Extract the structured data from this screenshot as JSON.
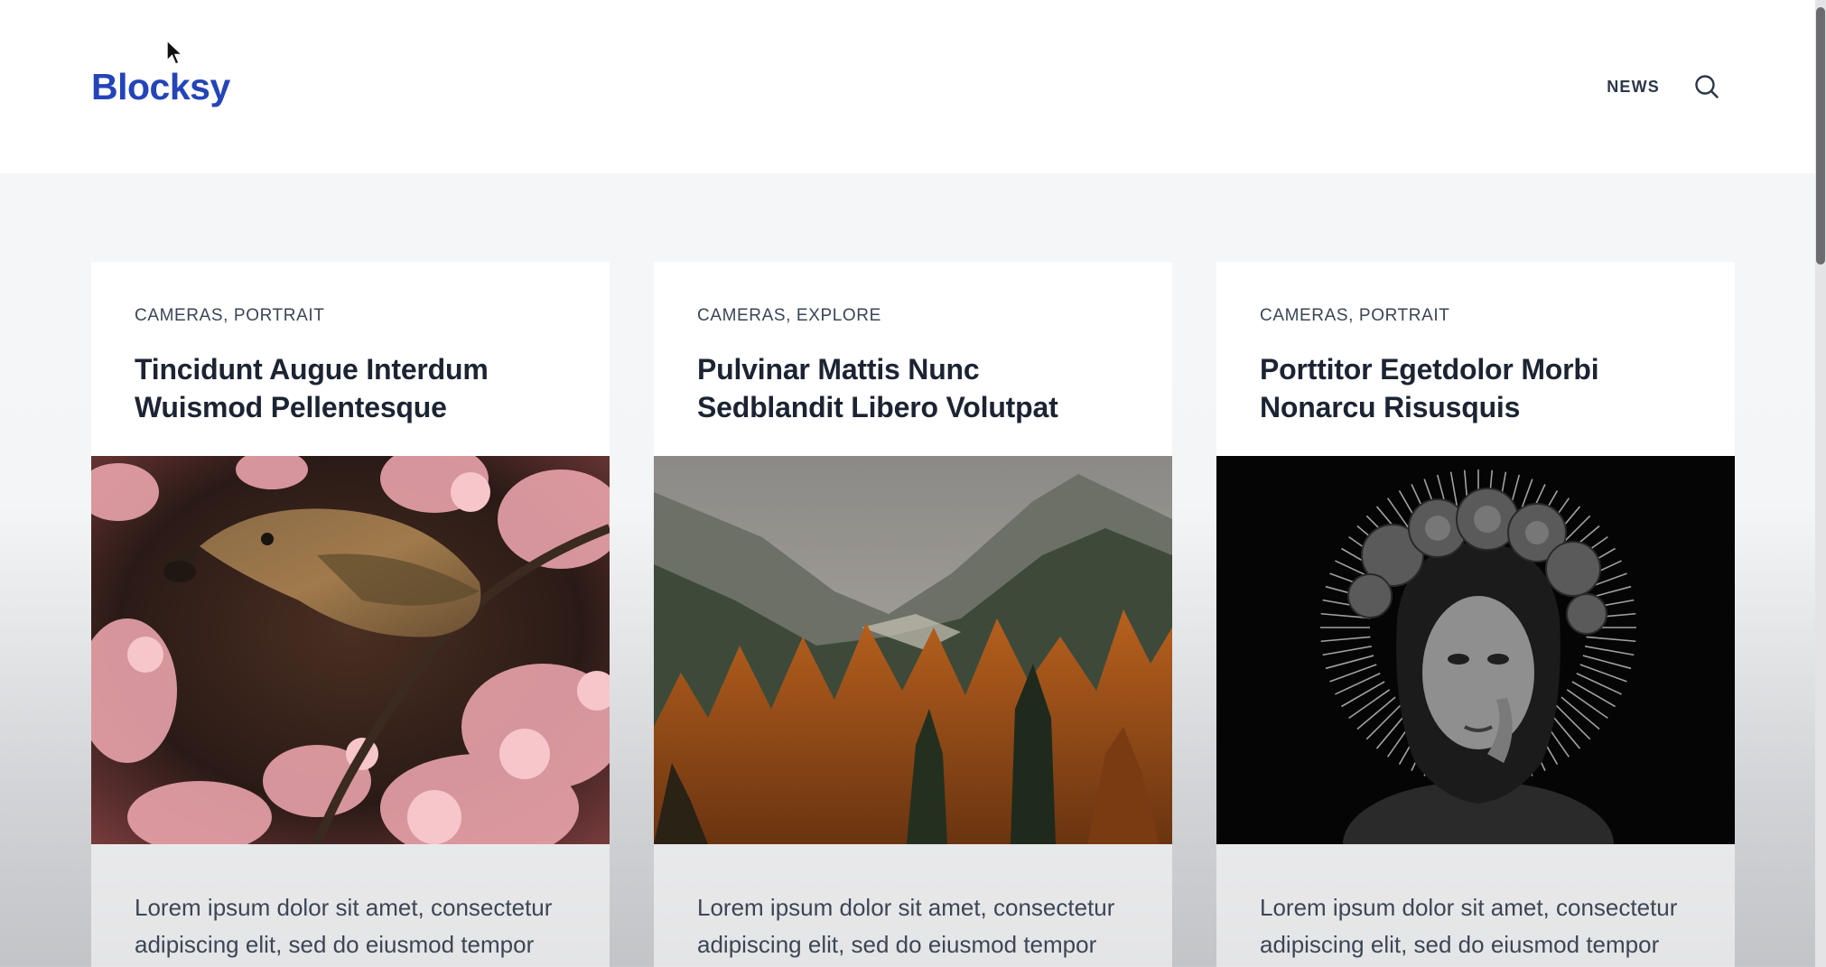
{
  "site": {
    "logo": "Blocksy",
    "brand_color": "#2444b8"
  },
  "nav": {
    "items": [
      {
        "label": "NEWS"
      }
    ],
    "search_icon": "search-icon"
  },
  "posts": [
    {
      "categories": "CAMERAS, PORTRAIT",
      "title": "Tincidunt Augue Interdum Wuismod Pellentesque",
      "image": "bird-on-cherry-blossom-branch",
      "excerpt": "Lorem ipsum dolor sit amet, consectetur adipiscing elit, sed do eiusmod tempor"
    },
    {
      "categories": "CAMERAS, EXPLORE",
      "title": "Pulvinar Mattis Nunc Sedblandit Libero Volutpat",
      "image": "autumn-forest-mountains",
      "excerpt": "Lorem ipsum dolor sit amet, consectetur adipiscing elit, sed do eiusmod tempor"
    },
    {
      "categories": "CAMERAS, PORTRAIT",
      "title": "Porttitor Egetdolor Morbi Nonarcu Risusquis",
      "image": "woman-flower-crown-bw-portrait",
      "excerpt": "Lorem ipsum dolor sit amet, consectetur adipiscing elit, sed do eiusmod tempor"
    }
  ]
}
